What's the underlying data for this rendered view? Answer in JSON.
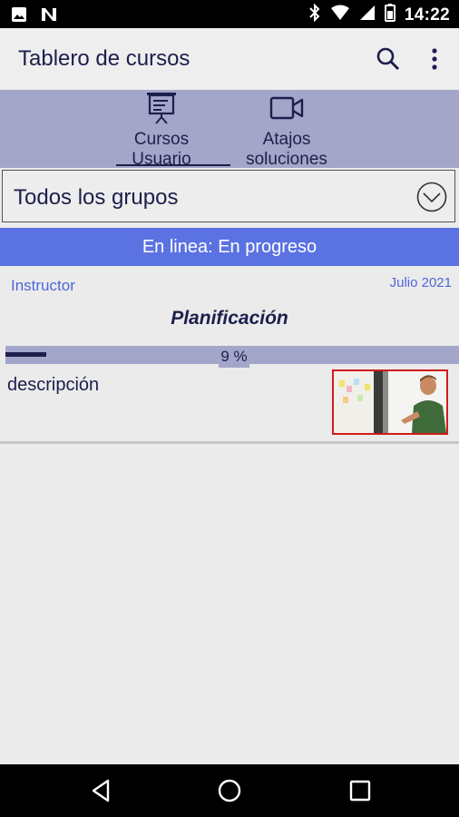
{
  "status_bar": {
    "time": "14:22",
    "icons": [
      "image-icon",
      "n-logo-icon",
      "bluetooth-icon",
      "wifi-icon",
      "signal-icon",
      "battery-icon"
    ]
  },
  "app_bar": {
    "title": "Tablero de cursos",
    "icons": [
      "search-icon",
      "more-vert-icon"
    ]
  },
  "tabs": [
    {
      "label_line1": "Cursos",
      "label_line2": "Usuario",
      "icon": "presentation-icon",
      "selected": true
    },
    {
      "label_line1": "Atajos",
      "label_line2": "soluciones",
      "icon": "video-camera-icon",
      "selected": false
    }
  ],
  "group_select": {
    "value": "Todos los grupos",
    "icon": "chevron-down-circle-icon"
  },
  "status_banner": {
    "text": "En linea: En progreso"
  },
  "course": {
    "instructor": "Instructor",
    "date": "Julio 2021",
    "title": "Planificación",
    "progress_percent": 9,
    "progress_label": "9 %",
    "description": "descripción"
  },
  "nav": {
    "icons": [
      "back-icon",
      "home-icon",
      "recents-icon"
    ]
  },
  "colors": {
    "primary_dark": "#1d1f4c",
    "tab_bg": "#a3a6c9",
    "banner": "#5b72e2",
    "link": "#4f66d8",
    "thumb_border": "#d21b1b"
  }
}
